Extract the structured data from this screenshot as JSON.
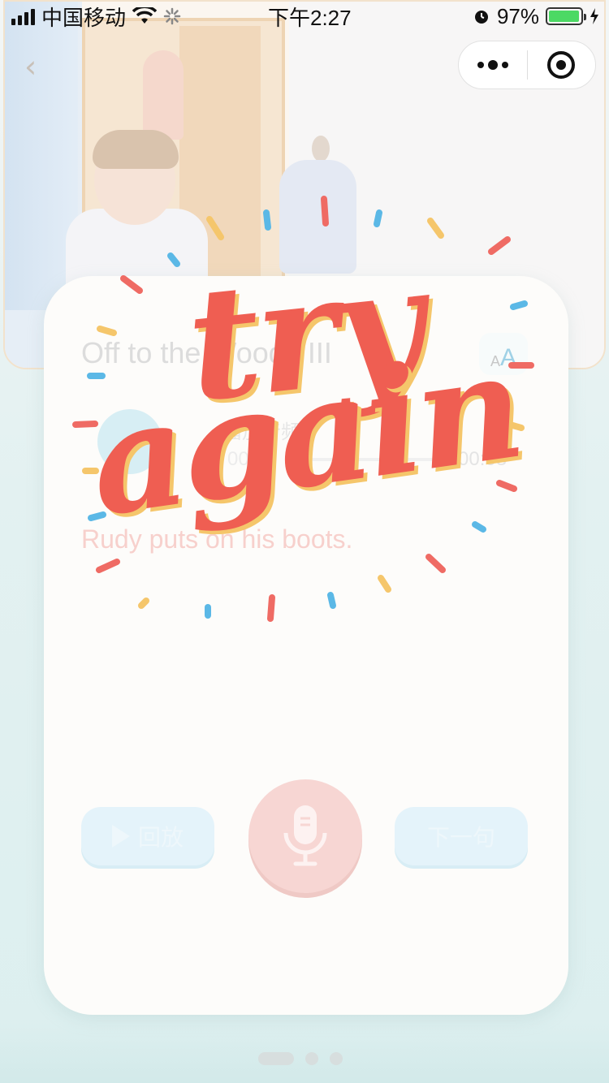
{
  "status_bar": {
    "carrier": "中国移动",
    "time": "下午2:27",
    "battery_percent": "97%",
    "battery_level": 0.97
  },
  "nav": {
    "back_icon": "chevron-left-icon",
    "more_icon": "more-icon",
    "close_icon": "target-close-icon"
  },
  "lesson": {
    "title": "Off to the Woods III",
    "font_size_small": "A",
    "font_size_big": "A",
    "audio_label": "播放音频",
    "audio_current": "00:00",
    "audio_total": "00:03",
    "audio_progress": 0.0,
    "sentence": "Rudy puts on his boots."
  },
  "controls": {
    "replay_label": "回放",
    "next_label": "下一句",
    "mic_icon": "microphone-icon"
  },
  "overlay": {
    "line1": "try",
    "line2": "again"
  },
  "colors": {
    "accent_red": "#ef5e52",
    "accent_yellow": "#f5c66b",
    "accent_blue": "#5bb8e6",
    "battery": "#4cd964"
  }
}
